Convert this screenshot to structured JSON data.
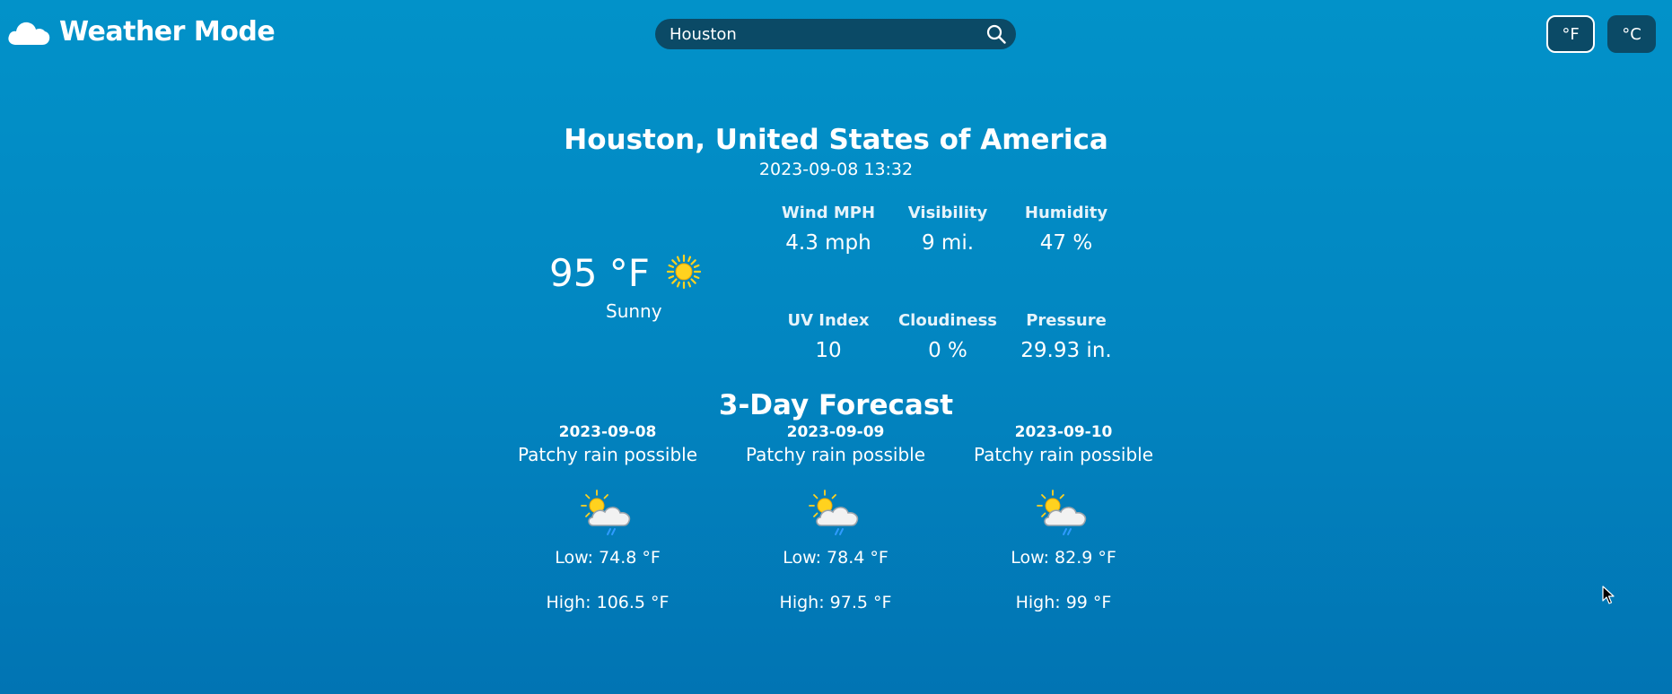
{
  "header": {
    "app_title": "Weather Mode",
    "logo_icon": "cloud-icon",
    "search": {
      "value": "Houston",
      "icon": "search-icon"
    },
    "units": {
      "fahrenheit": "°F",
      "celsius": "°C",
      "selected": "fahrenheit"
    }
  },
  "current": {
    "location": "Houston, United States of America",
    "datetime": "2023-09-08 13:32",
    "temperature": "95 °F",
    "condition": "Sunny",
    "condition_icon": "sun-icon",
    "stats": [
      {
        "label": "Wind MPH",
        "value": "4.3 mph"
      },
      {
        "label": "Visibility",
        "value": "9 mi."
      },
      {
        "label": "Humidity",
        "value": "47 %"
      },
      {
        "label": "UV Index",
        "value": "10"
      },
      {
        "label": "Cloudiness",
        "value": "0 %"
      },
      {
        "label": "Pressure",
        "value": "29.93 in."
      }
    ]
  },
  "forecast": {
    "title": "3-Day Forecast",
    "days": [
      {
        "date": "2023-09-08",
        "condition": "Patchy rain possible",
        "icon": "patchy-rain-icon",
        "low": "Low: 74.8 °F",
        "high": "High: 106.5 °F"
      },
      {
        "date": "2023-09-09",
        "condition": "Patchy rain possible",
        "icon": "patchy-rain-icon",
        "low": "Low: 78.4 °F",
        "high": "High: 97.5 °F"
      },
      {
        "date": "2023-09-10",
        "condition": "Patchy rain possible",
        "icon": "patchy-rain-icon",
        "low": "Low: 82.9 °F",
        "high": "High: 99 °F"
      }
    ]
  },
  "colors": {
    "background_top": "#0292c9",
    "background_bottom": "#0174b3",
    "control_background": "#0b4a66",
    "sun": "#ffd21f",
    "rain": "#2f9bff"
  }
}
